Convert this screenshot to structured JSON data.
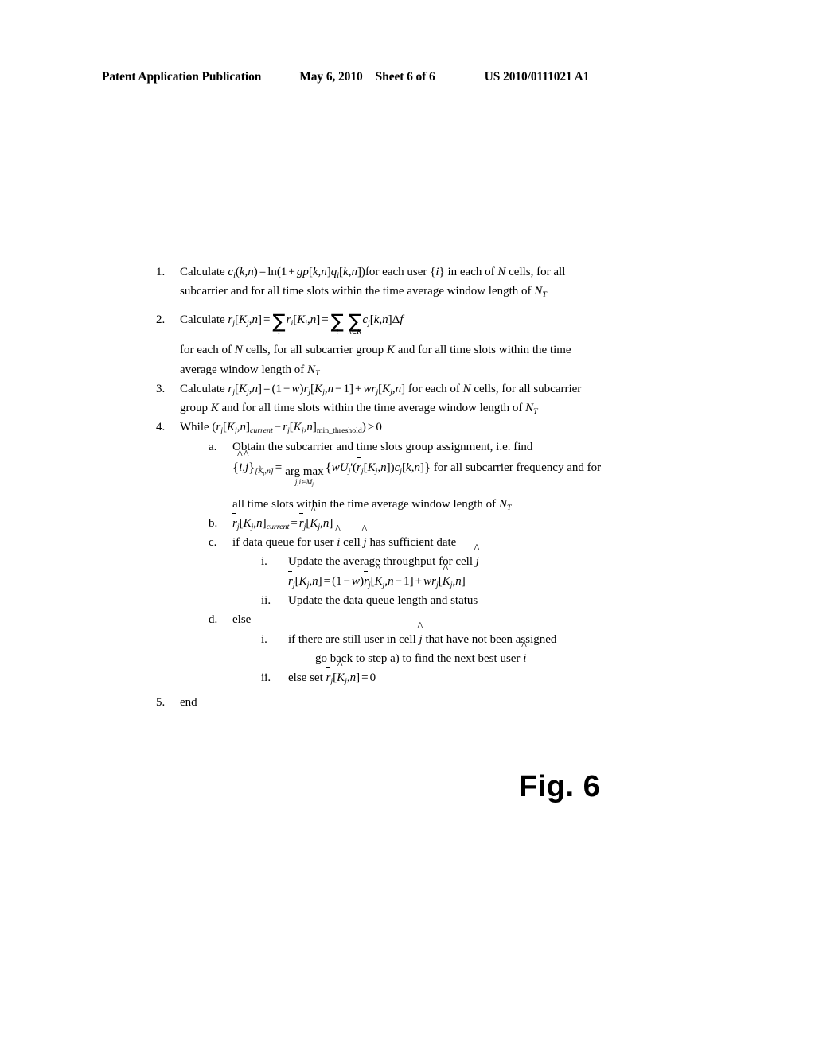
{
  "header": {
    "publication": "Patent Application Publication",
    "date": "May 6, 2010",
    "sheet": "Sheet 6 of 6",
    "patent_number": "US 2010/0111021 A1"
  },
  "figure": {
    "caption": "Fig. 6"
  },
  "algorithm": {
    "markers": {
      "n1": "1.",
      "n2": "2.",
      "n3": "3.",
      "n4": "4.",
      "n5": "5.",
      "a": "a.",
      "b": "b.",
      "c": "c.",
      "d": "d.",
      "i": "i.",
      "ii": "ii."
    },
    "step1": {
      "lead": "Calculate",
      "formula": "c_i(k,n) = ln(1 + gp[k,n]q_i[k,n])",
      "tail": "for each user {i} in each of N cells, for all",
      "line2": "subcarrier and for all time slots within the time average window length of N_T"
    },
    "step2": {
      "lead": "Calculate",
      "formula": "r_j[K_j,n] = ∑_i r_i[K_i,n] = ∑_i ∑_{k∈K} c_j[k,n]Δf",
      "line2": "for each of N cells, for all subcarrier group K and for all time slots within the time",
      "line3": "average window length of N_T"
    },
    "step3": {
      "lead": "Calculate",
      "formula": "r̄_j[K_j,n] = (1−w)r̄_j[K_j,n−1] + wr_j[K_j,n]",
      "tail": "for each of N cells, for all subcarrier",
      "line2": "group K and for all time slots within the time average window length of N_T"
    },
    "step4": {
      "lead": "While",
      "condition": "(r̄_j[K_j,n]_current − r̄_j[K_j,n]_min_threshold) > 0",
      "a": {
        "text": "Obtain the subcarrier and time slots group assignment, i.e. find",
        "formula": "{î,ĵ}_[K̂_j,n] = arg max_{j,i∈M_j} {wU_j'(r̄_j[K_j,n])c_j[k,n]}",
        "formula_tail": "for all subcarrier frequency and for",
        "line3": "all time slots within the time average window length of N_T"
      },
      "b": {
        "formula": "r̄_j[K_j,n]_current = r̄_j[K̂_j,n]"
      },
      "c": {
        "text_pre": "if data queue for user",
        "var1": "î",
        "text_mid": "cell",
        "var2": "ĵ",
        "text_post": "has sufficient date",
        "i": {
          "text": "Update the average throughput for cell",
          "var": "ĵ",
          "formula": "r̄_j[K_j,n] = (1−w)r̄_j[K̂_j,n−1] + wr_j[K̂_j,n]"
        },
        "ii": {
          "text": "Update the data queue length and status"
        }
      },
      "d": {
        "text": "else",
        "i": {
          "text_pre": "if there are still user in cell",
          "var": "ĵ",
          "text_post": "that have not been assigned",
          "line2_pre": "go back to step a) to find the next best user",
          "line2_var": "î"
        },
        "ii": {
          "text": "else set",
          "formula": "r̄_j[K̂_j,n] = 0"
        }
      }
    },
    "step5": {
      "text": "end"
    }
  }
}
